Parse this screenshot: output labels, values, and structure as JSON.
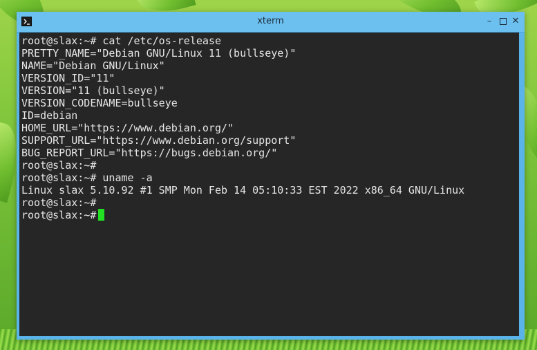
{
  "window": {
    "title": "xterm",
    "controls": {
      "minimize": "–",
      "close": "✕"
    },
    "accent_color": "#6cc0f0"
  },
  "terminal": {
    "background": "#262626",
    "foreground": "#e6e6e6",
    "cursor_color": "#22e022",
    "lines": [
      "root@slax:~# cat /etc/os-release",
      "PRETTY_NAME=\"Debian GNU/Linux 11 (bullseye)\"",
      "NAME=\"Debian GNU/Linux\"",
      "VERSION_ID=\"11\"",
      "VERSION=\"11 (bullseye)\"",
      "VERSION_CODENAME=bullseye",
      "ID=debian",
      "HOME_URL=\"https://www.debian.org/\"",
      "SUPPORT_URL=\"https://www.debian.org/support\"",
      "BUG_REPORT_URL=\"https://bugs.debian.org/\"",
      "root@slax:~#",
      "root@slax:~# uname -a",
      "Linux slax 5.10.92 #1 SMP Mon Feb 14 05:10:33 EST 2022 x86_64 GNU/Linux",
      "root@slax:~#"
    ],
    "current_prompt": "root@slax:~#"
  },
  "desktop": {
    "wallpaper": "green-leaves"
  }
}
